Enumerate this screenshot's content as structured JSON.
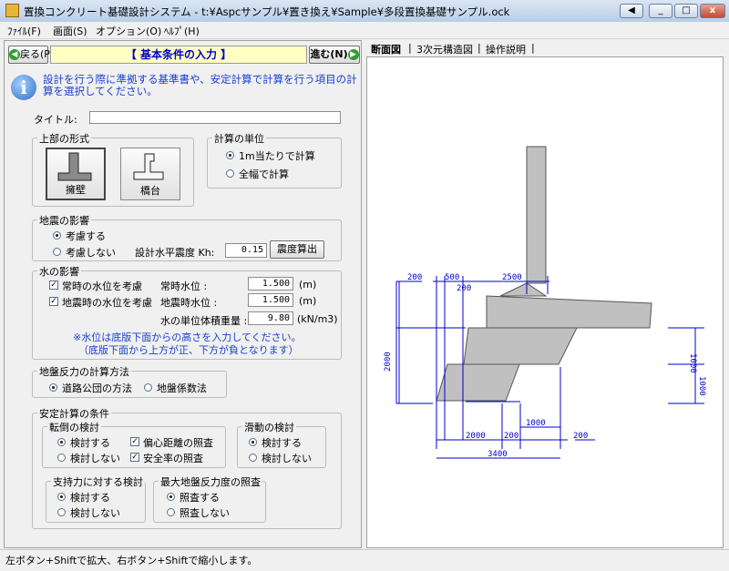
{
  "window": {
    "title": "置換コンクリート基礎設計システム - t:¥Aspcサンプル¥置き換え¥Sample¥多段置換基礎サンプル.ock",
    "arrow_btn": "◀",
    "min_btn": "_",
    "max_btn": "□",
    "close_btn": "x"
  },
  "menu": [
    "ﾌｧｲﾙ(F)",
    "画面(S)",
    "オプション(O)",
    "ﾍﾙﾌﾟ(H)"
  ],
  "nav": {
    "back_label": "戻る(P)",
    "section_title": "【 基本条件の入力 】",
    "next_label": "進む(N)"
  },
  "info_text": "設計を行う際に準拠する基準書や、安定計算で計算を行う項目の計算を選択してください。",
  "title_field": {
    "label": "タイトル:",
    "value": ""
  },
  "superstructure": {
    "label": "上部の形式",
    "options": [
      "擁壁",
      "橋台"
    ],
    "selected": "擁壁"
  },
  "calc_unit": {
    "label": "計算の単位",
    "options": [
      "1m当たりで計算",
      "全幅で計算"
    ],
    "selected": "1m当たりで計算"
  },
  "seismic": {
    "label": "地震の影響",
    "options": [
      "考慮する",
      "考慮しない"
    ],
    "selected": "考慮する",
    "kh_label": "設計水平震度  Kh:",
    "kh_value": "0.15",
    "calc_button": "震度算出"
  },
  "water": {
    "label": "水の影響",
    "normal_check": "常時の水位を考慮",
    "normal_checked": true,
    "quake_check": "地震時の水位を考慮",
    "quake_checked": true,
    "normal_level_label": "常時水位   :",
    "normal_level_value": "1.500",
    "quake_level_label": "地震時水位  :",
    "quake_level_value": "1.500",
    "unit_weight_label": "水の単位体積重量 :",
    "unit_weight_value": "9.80",
    "unit_m": "(m)",
    "unit_weight_unit": "(kN/m3)",
    "note1": "※水位は底版下面からの高さを入力してください。",
    "note2": "（底版下面から上方が正、下方が負となります）"
  },
  "reaction": {
    "label": "地盤反力の計算方法",
    "options": [
      "道路公団の方法",
      "地盤係数法"
    ],
    "selected": "道路公団の方法"
  },
  "stability": {
    "label": "安定計算の条件",
    "overturn": {
      "label": "転倒の検討",
      "options": [
        "検討する",
        "検討しない"
      ],
      "selected": "検討する",
      "check1": "偏心距離の照査",
      "check1_on": true,
      "check2": "安全率の照査",
      "check2_on": true
    },
    "sliding": {
      "label": "滑動の検討",
      "options": [
        "検討する",
        "検討しない"
      ],
      "selected": "検討する"
    },
    "bearing": {
      "label": "支持力に対する検討",
      "options": [
        "検討する",
        "検討しない"
      ],
      "selected": "検討する"
    },
    "max_reaction": {
      "label": "最大地盤反力度の照査",
      "options": [
        "照査する",
        "照査しない"
      ],
      "selected": "照査する"
    }
  },
  "tabs": [
    "断面図",
    "3次元構造図",
    "操作説明"
  ],
  "active_tab": "断面図",
  "drawing": {
    "dimensions": {
      "top_200": "200",
      "top_500": "500",
      "top_200b": "200",
      "top_2500": "2500",
      "left_2000": "2000",
      "right_1000a": "1000",
      "right_1000b": "1000",
      "bottom_1000": "1000",
      "bottom_2000": "2000",
      "bottom_200a": "200",
      "bottom_200b": "200",
      "bottom_3400": "3400"
    },
    "colors": {
      "concrete": "#c0c0c0",
      "dimension": "#0000cc"
    }
  },
  "status": "左ボタン+Shiftで拡大、右ボタン+Shiftで縮小します。"
}
